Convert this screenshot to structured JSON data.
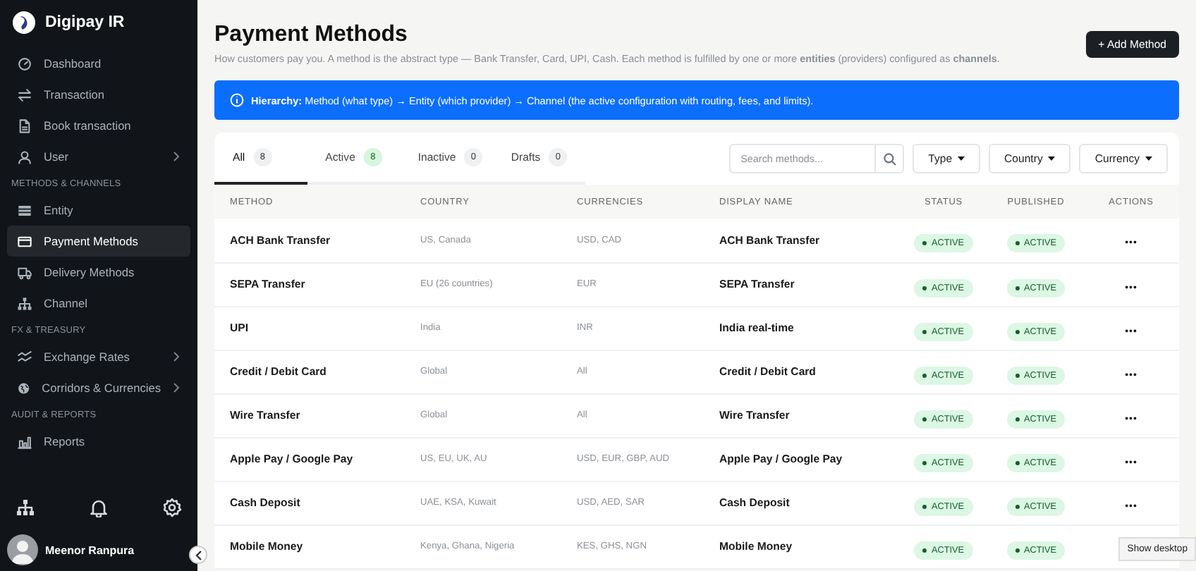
{
  "sidebar": {
    "brand": "Digipay IR",
    "sections": [
      {
        "items": [
          {
            "label": "Dashboard",
            "selected": false,
            "submenu": false
          },
          {
            "label": "Transaction",
            "selected": false,
            "submenu": false
          },
          {
            "label": "Book transaction",
            "selected": false,
            "submenu": false
          },
          {
            "label": "User",
            "selected": false,
            "submenu": true
          }
        ]
      },
      {
        "heading": "METHODS & CHANNELS",
        "items": [
          {
            "label": "Entity",
            "selected": false,
            "submenu": false
          },
          {
            "label": "Payment Methods",
            "selected": true,
            "submenu": false
          },
          {
            "label": "Delivery Methods",
            "selected": false,
            "submenu": false
          },
          {
            "label": "Channel",
            "selected": false,
            "submenu": false
          }
        ]
      },
      {
        "heading": "FX & TREASURY",
        "items": [
          {
            "label": "Exchange Rates",
            "selected": false,
            "submenu": true
          },
          {
            "label": "Corridors & Currencies",
            "selected": false,
            "submenu": true
          }
        ]
      },
      {
        "heading": "AUDIT & REPORTS",
        "items": [
          {
            "label": "Reports",
            "selected": false,
            "submenu": false
          }
        ]
      }
    ],
    "user": {
      "name": "Meenor Ranpura"
    }
  },
  "header": {
    "title": "Payment Methods",
    "subtitle": "How customers pay you. A method is the abstract type — Bank Transfer, Card, UPI, Cash. Each method is fulfilled by one or more **entities** (providers) configured as **channels**.",
    "add_button": "+ Add Method"
  },
  "banner": {
    "text": "**Hierarchy:** Method (what type) → Entity (which provider) → Channel (the active configuration with routing, fees, and limits)."
  },
  "tabs": [
    {
      "label": "All",
      "count": "8",
      "kind": "neutral",
      "selected": true
    },
    {
      "label": "Active",
      "count": "8",
      "kind": "success",
      "selected": false
    },
    {
      "label": "Inactive",
      "count": "0",
      "kind": "neutral",
      "selected": false
    },
    {
      "label": "Drafts",
      "count": "0",
      "kind": "neutral",
      "selected": false
    }
  ],
  "search": {
    "placeholder": "Search methods..."
  },
  "filters": [
    "Type",
    "Country",
    "Currency"
  ],
  "table": {
    "columns": [
      "METHOD",
      "COUNTRY",
      "CURRENCIES",
      "DISPLAY NAME",
      "STATUS",
      "PUBLISHED",
      "ACTIONS"
    ],
    "rows": [
      {
        "method": "ACH Bank Transfer",
        "country": "US, Canada",
        "currencies": "USD, CAD",
        "display_name": "ACH Bank Transfer",
        "status": {
          "label": "ACTIVE",
          "kind": "active"
        },
        "published": {
          "label": "ACTIVE",
          "kind": "active"
        },
        "actions": "•••"
      },
      {
        "method": "SEPA Transfer",
        "country": "EU (26 countries)",
        "currencies": "EUR",
        "display_name": "SEPA Transfer",
        "status": {
          "label": "ACTIVE",
          "kind": "active"
        },
        "published": {
          "label": "ACTIVE",
          "kind": "active"
        },
        "actions": "•••"
      },
      {
        "method": "UPI",
        "country": "India",
        "currencies": "INR",
        "display_name": "India real-time",
        "status": {
          "label": "ACTIVE",
          "kind": "active"
        },
        "published": {
          "label": "ACTIVE",
          "kind": "active"
        },
        "actions": "•••"
      },
      {
        "method": "Credit / Debit Card",
        "country": "Global",
        "currencies": "All",
        "display_name": "Credit / Debit Card",
        "status": {
          "label": "ACTIVE",
          "kind": "active"
        },
        "published": {
          "label": "ACTIVE",
          "kind": "active"
        },
        "actions": "•••"
      },
      {
        "method": "Wire Transfer",
        "country": "Global",
        "currencies": "All",
        "display_name": "Wire Transfer",
        "status": {
          "label": "ACTIVE",
          "kind": "active"
        },
        "published": {
          "label": "ACTIVE",
          "kind": "active"
        },
        "actions": "•••"
      },
      {
        "method": "Apple Pay / Google Pay",
        "country": "US, EU, UK, AU",
        "currencies": "USD, EUR, GBP, AUD",
        "display_name": "Apple Pay / Google Pay",
        "status": {
          "label": "ACTIVE",
          "kind": "active"
        },
        "published": {
          "label": "ACTIVE",
          "kind": "active"
        },
        "actions": "•••"
      },
      {
        "method": "Cash Deposit",
        "country": "UAE, KSA, Kuwait",
        "currencies": "USD, AED, SAR",
        "display_name": "Cash Deposit",
        "status": {
          "label": "ACTIVE",
          "kind": "active"
        },
        "published": {
          "label": "ACTIVE",
          "kind": "active"
        },
        "actions": "•••"
      },
      {
        "method": "Mobile Money",
        "country": "Kenya, Ghana, Nigeria",
        "currencies": "KES, GHS, NGN",
        "display_name": "Mobile Money",
        "status": {
          "label": "ACTIVE",
          "kind": "active"
        },
        "published": {
          "label": "ACTIVE",
          "kind": "active"
        }
      }
    ]
  },
  "tooltip": {
    "text": "Show desktop"
  }
}
